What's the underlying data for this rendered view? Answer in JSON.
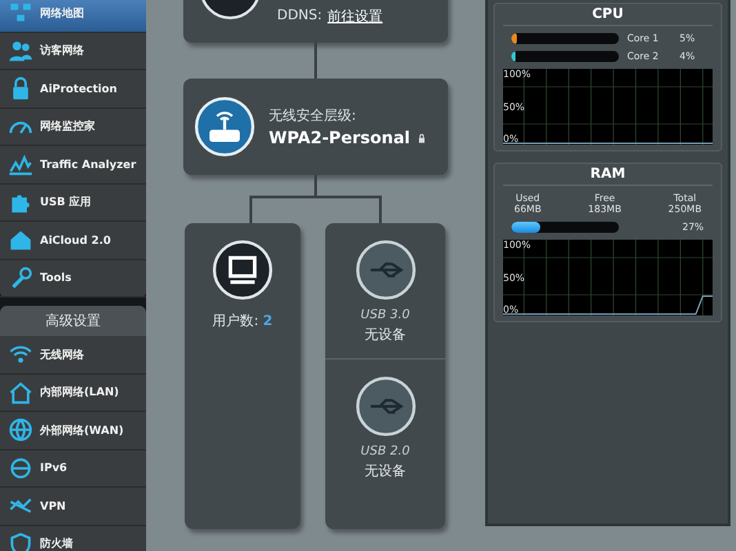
{
  "sidebar": {
    "general_items": [
      {
        "label": "网络地图",
        "selected": true
      },
      {
        "label": "访客网络",
        "selected": false
      },
      {
        "label": "AiProtection",
        "selected": false
      },
      {
        "label": "网络监控家",
        "selected": false
      },
      {
        "label": "Traffic Analyzer",
        "selected": false
      },
      {
        "label": "USB 应用",
        "selected": false
      },
      {
        "label": "AiCloud 2.0",
        "selected": false
      },
      {
        "label": "Tools",
        "selected": false
      }
    ],
    "advanced_header": "高级设置",
    "advanced_items": [
      {
        "label": "无线网络",
        "selected": false
      },
      {
        "label": "内部网络(LAN)",
        "selected": false
      },
      {
        "label": "外部网络(WAN)",
        "selected": false
      },
      {
        "label": "IPv6",
        "selected": false
      },
      {
        "label": "VPN",
        "selected": false
      },
      {
        "label": "防火墙",
        "selected": false
      }
    ]
  },
  "map": {
    "internet": {
      "ddns_label": "DDNS:",
      "ddns_link": "前往设置"
    },
    "wireless": {
      "security_label": "无线安全层级:",
      "security_value": "WPA2-Personal"
    },
    "clients": {
      "label": "用户数:",
      "count": "2"
    },
    "usb_ports": [
      {
        "name": "USB 3.0",
        "status": "无设备"
      },
      {
        "name": "USB 2.0",
        "status": "无设备"
      }
    ]
  },
  "cpu": {
    "title": "CPU",
    "cores": [
      {
        "name": "Core 1",
        "level": 0.05,
        "reading": "5%",
        "color": "#e8891e"
      },
      {
        "name": "Core 2",
        "level": 0.04,
        "reading": "4%",
        "color": "#35c6d6"
      }
    ],
    "graph_labels": [
      "100%",
      "50%",
      "0%"
    ]
  },
  "ram": {
    "title": "RAM",
    "stats": [
      {
        "label": "Used",
        "value": "66MB"
      },
      {
        "label": "Free",
        "value": "183MB"
      },
      {
        "label": "Total",
        "value": "250MB"
      }
    ],
    "level": 0.27,
    "reading": "27%",
    "graph_labels": [
      "100%",
      "50%",
      "0%"
    ]
  }
}
